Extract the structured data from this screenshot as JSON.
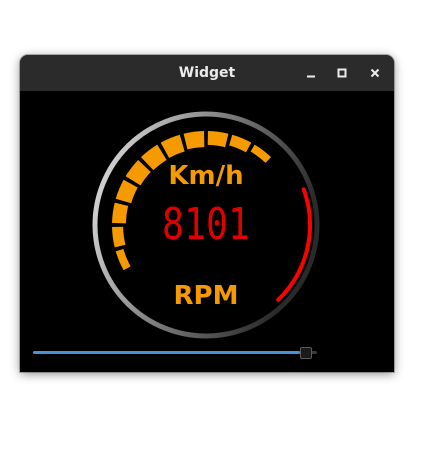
{
  "window": {
    "title": "Widget"
  },
  "controls": {
    "minimize_icon": "minimize-icon",
    "maximize_icon": "maximize-icon",
    "close_icon": "close-icon"
  },
  "gauge": {
    "speed_unit": "Km/h",
    "rpm_label": "RPM",
    "digital_readout": "8101",
    "speed_level": 0.69,
    "rpm_level": 0.3,
    "colors": {
      "accent": "#f59a00",
      "readout": "#e00000",
      "rpm_arc": "#ff0000",
      "ring_light": "#e8e8e8",
      "ring_dark": "#2a2a2a"
    }
  },
  "slider": {
    "level": 0.96,
    "color": "#4a90d9"
  }
}
